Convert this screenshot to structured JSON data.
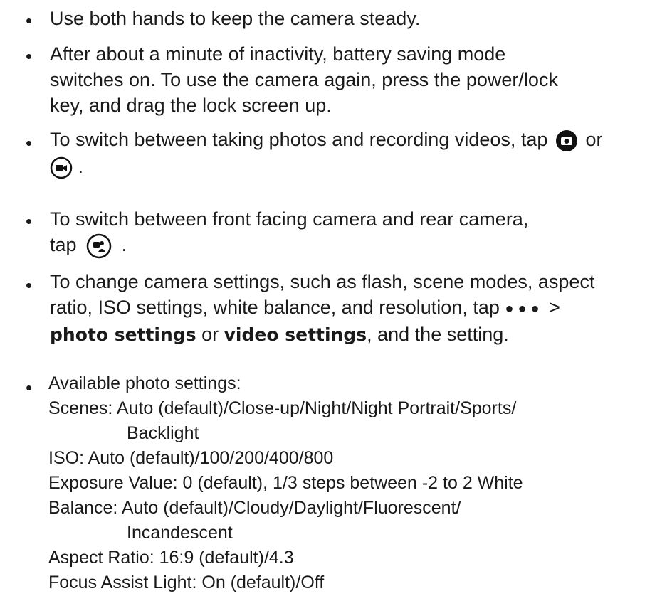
{
  "bullets": {
    "b1": "Use both hands to keep the camera steady.",
    "b2": {
      "l1": "After about a minute of inactivity, battery saving mode",
      "l2": "switches on.  To use the camera again, press the power/lock",
      "l3": "key, and drag the lock screen up."
    },
    "b3": {
      "before": "To switch between taking photos and recording videos, tap",
      "or": "or",
      "end": "."
    },
    "b4": {
      "l1": "To switch between front facing camera and rear camera,",
      "l2a": "tap",
      "l2end": "."
    },
    "b5": {
      "l1": "To change camera settings, such as flash, scene modes, aspect",
      "l2": "ratio, ISO settings, white balance, and resolution, tap",
      "gt": ">",
      "photo_settings": "photo settings",
      "or": "or",
      "video_settings": "video settings",
      "tail": ",  and the setting."
    },
    "b6": {
      "heading": "Available photo settings:",
      "l1": "Scenes: Auto (default)/Close-up/Night/Night Portrait/Sports/",
      "l2": "Backlight",
      "l3": "ISO: Auto (default)/100/200/400/800",
      "l4": "Exposure Value: 0 (default), 1/3 steps between -2 to 2 White",
      "l5": "Balance: Auto (default)/Cloudy/Daylight/Fluorescent/",
      "l6": "Incandescent",
      "l7": "Aspect Ratio: 16:9 (default)/4.3",
      "l8": "Focus Assist Light: On (default)/Off"
    }
  },
  "icons": {
    "camera_icon": "camera-icon",
    "video_icon": "video-camera-icon",
    "switch_camera_icon": "switch-camera-icon",
    "more_dots_icon": "more-options-icon"
  },
  "colors": {
    "text": "#1a1a1a",
    "icon": "#111111"
  }
}
